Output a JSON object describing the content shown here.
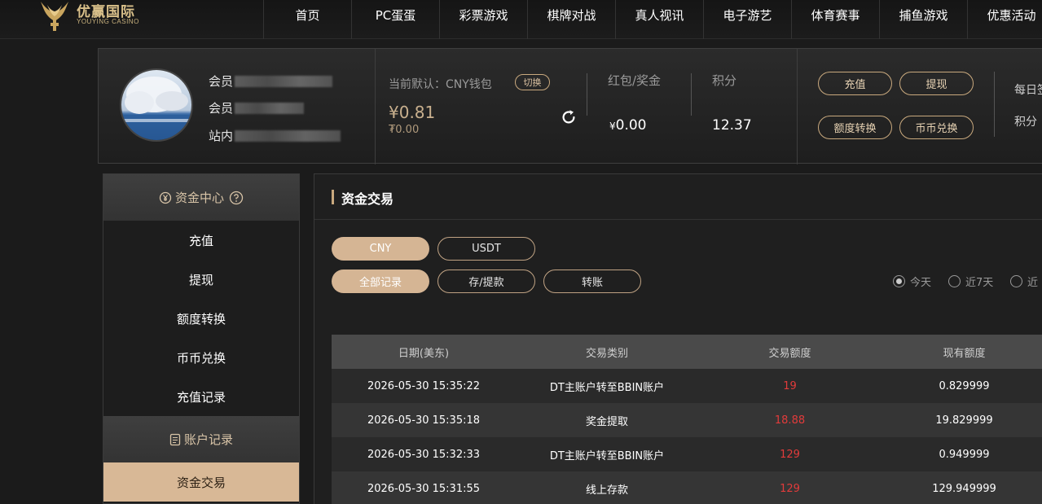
{
  "brand": {
    "name_cn": "优赢国际",
    "name_en": "YOUYING CASINO",
    "color": "#d9c08a"
  },
  "nav": [
    {
      "label": "首页"
    },
    {
      "label": "PC蛋蛋"
    },
    {
      "label": "彩票游戏"
    },
    {
      "label": "棋牌对战"
    },
    {
      "label": "真人视讯"
    },
    {
      "label": "电子游艺"
    },
    {
      "label": "体育赛事"
    },
    {
      "label": "捕鱼游戏"
    },
    {
      "label": "优惠活动"
    }
  ],
  "account": {
    "lines": [
      "会员",
      "会员",
      "站内"
    ],
    "wallet_label": "当前默认：CNY钱包",
    "switch_label": "切换",
    "balance": "¥0.81",
    "balance_sub": "₮0.00",
    "bonus_label": "红包/奖金",
    "bonus_currency": "¥",
    "bonus_value": "0.00",
    "points_label": "积分",
    "points_value": "12.37",
    "buttons": [
      "充值",
      "提现",
      "额度转换",
      "币币兑换"
    ],
    "extra": [
      "每日签",
      "积分"
    ]
  },
  "sidebar": {
    "section1": "资金中心",
    "items1": [
      "充值",
      "提现",
      "额度转换",
      "币币兑换",
      "充值记录"
    ],
    "section2": "账户记录",
    "items2": [
      "资金交易"
    ]
  },
  "main": {
    "title": "资金交易",
    "currency_tabs": [
      "CNY",
      "USDT"
    ],
    "type_tabs": [
      "全部记录",
      "存/提款",
      "转账"
    ],
    "date_filters": [
      "今天",
      "近7天",
      "近"
    ],
    "table": {
      "headers": [
        "日期(美东)",
        "交易类别",
        "交易额度",
        "现有额度"
      ],
      "rows": [
        [
          "2026-05-30 15:35:22",
          "DT主账户转至BBIN账户",
          "19",
          "0.829999"
        ],
        [
          "2026-05-30 15:35:18",
          "奖金提取",
          "18.88",
          "19.829999"
        ],
        [
          "2026-05-30 15:32:33",
          "DT主账户转至BBIN账户",
          "129",
          "0.949999"
        ],
        [
          "2026-05-30 15:31:55",
          "线上存款",
          "129",
          "129.949999"
        ]
      ]
    }
  },
  "colors": {
    "accent": "#d5b594",
    "negative": "#e23b3b",
    "background": "#1b1b1b"
  }
}
